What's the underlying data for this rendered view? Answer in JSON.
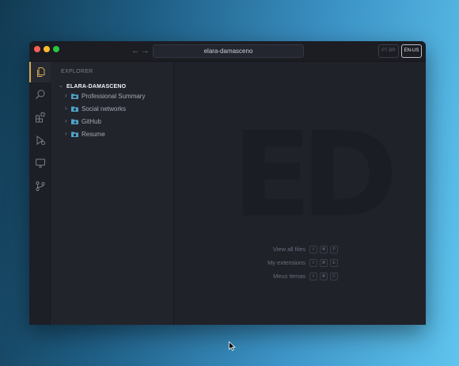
{
  "window": {
    "address": "elara-damasceno",
    "nav_back": "←",
    "nav_forward": "→",
    "lang_pt": "PT-BR",
    "lang_en": "EN-US"
  },
  "activity_bar": [
    {
      "name": "files-icon",
      "active": true
    },
    {
      "name": "search-icon",
      "active": false
    },
    {
      "name": "extensions-icon",
      "active": false
    },
    {
      "name": "run-debug-icon",
      "active": false
    },
    {
      "name": "monitor-icon",
      "active": false
    },
    {
      "name": "source-control-icon",
      "active": false
    }
  ],
  "sidebar": {
    "title": "EXPLORER",
    "root": "ELARA-DAMASCENO",
    "items": [
      {
        "label": "Professional Summary"
      },
      {
        "label": "Social networks"
      },
      {
        "label": "GitHub"
      },
      {
        "label": "Resume"
      }
    ]
  },
  "editor": {
    "logo": "ED",
    "shortcuts": [
      {
        "label": "View all files",
        "keys": [
          "⇧",
          "⌘",
          "P"
        ]
      },
      {
        "label": "My extensions",
        "keys": [
          "⇧",
          "⌘",
          "E"
        ]
      },
      {
        "label": "Meus temas",
        "keys": [
          "⇧",
          "⌘",
          "C"
        ]
      }
    ]
  },
  "colors": {
    "accent": "#d6a94c",
    "folder": "#4fa3c8"
  }
}
